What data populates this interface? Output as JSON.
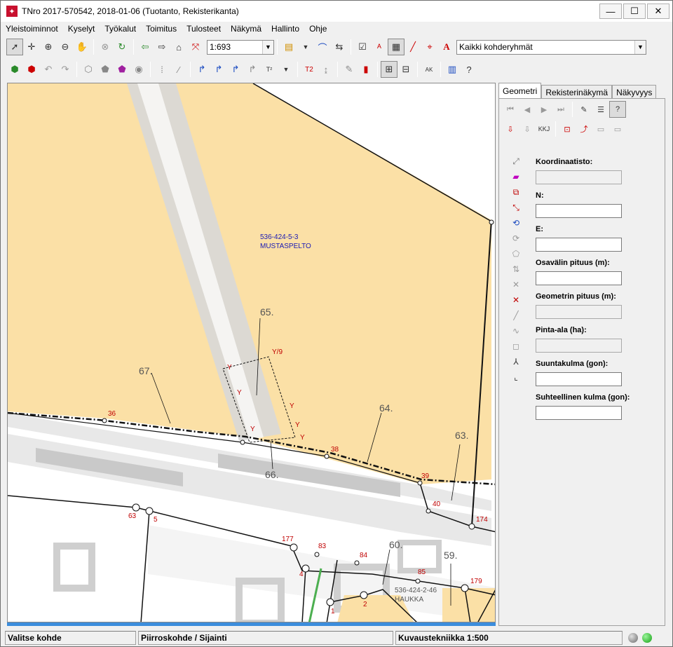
{
  "window": {
    "title": "TNro 2017-570542, 2018-01-06 (Tuotanto, Rekisterikanta)",
    "minimize": "—",
    "maximize": "☐",
    "close": "✕"
  },
  "menu": [
    "Yleistoiminnot",
    "Kyselyt",
    "Työkalut",
    "Toimitus",
    "Tulosteet",
    "Näkymä",
    "Hallinto",
    "Ohje"
  ],
  "toolbar": {
    "scale_value": "1:693",
    "group_value": "Kaikki kohderyhmät",
    "icons": [
      "select-arrow-icon",
      "crosshair-icon",
      "zoom-in-icon",
      "zoom-out-icon",
      "pan-hand-icon",
      "cancel-icon",
      "refresh-icon",
      "back-arrow-icon",
      "forward-arrow-icon",
      "home-icon",
      "measure-icon",
      "layers-icon",
      "snap-icon",
      "export-icon",
      "check-icon",
      "label-icon",
      "hatch-icon",
      "line-icon",
      "target-icon",
      "text-icon"
    ]
  },
  "map": {
    "labels": {
      "parcel_id": "536-424-5-3",
      "parcel_name": "MUSTASPELTO",
      "parcel2_id": "536-424-2-46",
      "parcel2_name": "HAUKKA",
      "n65": "65.",
      "n67": "67.",
      "n64": "64.",
      "n63": "63.",
      "n66": "66.",
      "n60": "60.",
      "n59": "59.",
      "y9": "Y/9",
      "y": "Y",
      "r36": "36",
      "r38": "38",
      "r39": "39",
      "r40": "40",
      "r174": "174",
      "r63": "63",
      "r5": "5",
      "r177": "177",
      "r83": "83",
      "r84": "84",
      "r85": "85",
      "r179": "179",
      "r4": "4",
      "r1": "1",
      "r2": "2"
    }
  },
  "side": {
    "tabs": [
      "Geometri",
      "Rekisterinäkymä",
      "Näkyvyys"
    ],
    "active_tab": "Geometri",
    "fields": [
      {
        "label": "Koordinaatisto:",
        "value": "",
        "disabled": true
      },
      {
        "label": "N:",
        "value": "",
        "disabled": false
      },
      {
        "label": "E:",
        "value": "",
        "disabled": false
      },
      {
        "label": "Osavälin pituus (m):",
        "value": "",
        "disabled": false
      },
      {
        "label": "Geometrin pituus (m):",
        "value": "",
        "disabled": true
      },
      {
        "label": "Pinta-ala (ha):",
        "value": "",
        "disabled": true
      },
      {
        "label": "Suuntakulma (gon):",
        "value": "",
        "disabled": false
      },
      {
        "label": "Suhteellinen kulma (gon):",
        "value": "",
        "disabled": false
      }
    ],
    "kkj_label": "KKJ"
  },
  "status": {
    "left": "Valitse kohde",
    "middle": "Piirroskohde / Sijainti",
    "right": "Kuvaustekniikka 1:500"
  }
}
